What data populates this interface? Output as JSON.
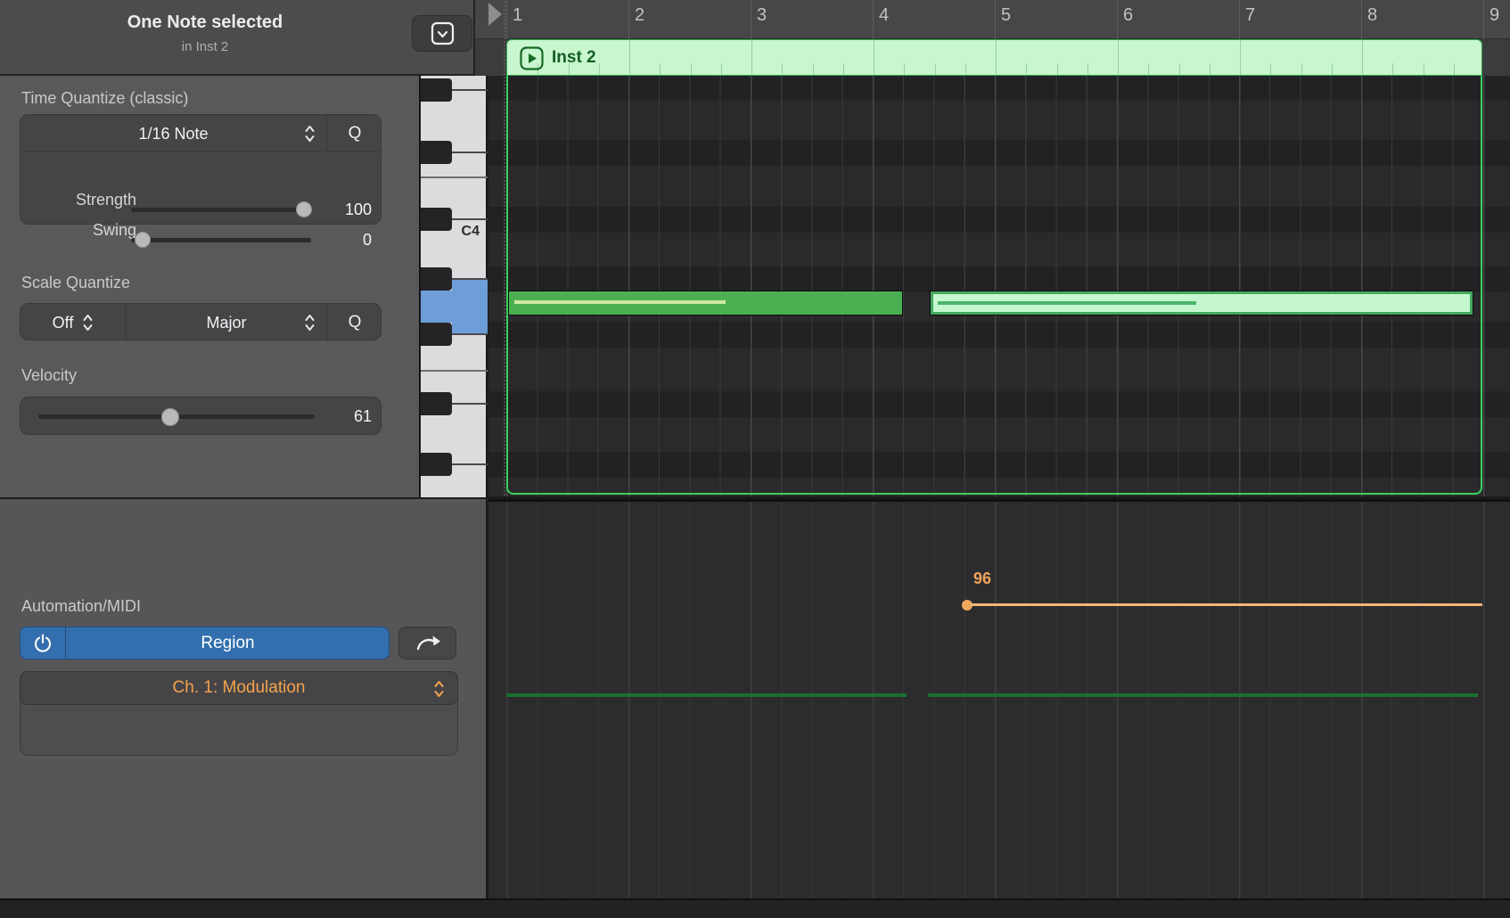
{
  "header": {
    "title": "One Note selected",
    "subtitle": "in Inst 2"
  },
  "time_quantize": {
    "label": "Time Quantize (classic)",
    "value": "1/16 Note",
    "q_label": "Q",
    "strength_label": "Strength",
    "strength_value": "100",
    "swing_label": "Swing",
    "swing_value": "0"
  },
  "scale_quantize": {
    "label": "Scale Quantize",
    "root_value": "Off",
    "scale_value": "Major",
    "q_label": "Q"
  },
  "velocity": {
    "label": "Velocity",
    "value": "61"
  },
  "automation": {
    "label": "Automation/MIDI",
    "mode_value": "Region",
    "param_value": "Ch. 1: Modulation",
    "point_value": "96"
  },
  "keyboard": {
    "c4_label": "C4"
  },
  "ruler": {
    "bars": [
      "1",
      "2",
      "3",
      "4",
      "5",
      "6",
      "7",
      "8",
      "9"
    ]
  },
  "region": {
    "name": "Inst 2"
  },
  "icons": {
    "header_disclosure": "chevron-down-in-box",
    "stepper": "up-down-chevrons",
    "power": "power-symbol",
    "route": "curved-arrow-right",
    "region_play": "play-in-rounded-square"
  },
  "colors": {
    "accent_green_region": "#c8f6cf",
    "note_selected": "#4cb052",
    "note_unselected": "#c4f7cf",
    "automation_orange": "#f0a860",
    "note_indicator_green": "#1d6f2d",
    "region_button_blue": "#336fae",
    "selected_key_blue": "#6d9ed8"
  }
}
